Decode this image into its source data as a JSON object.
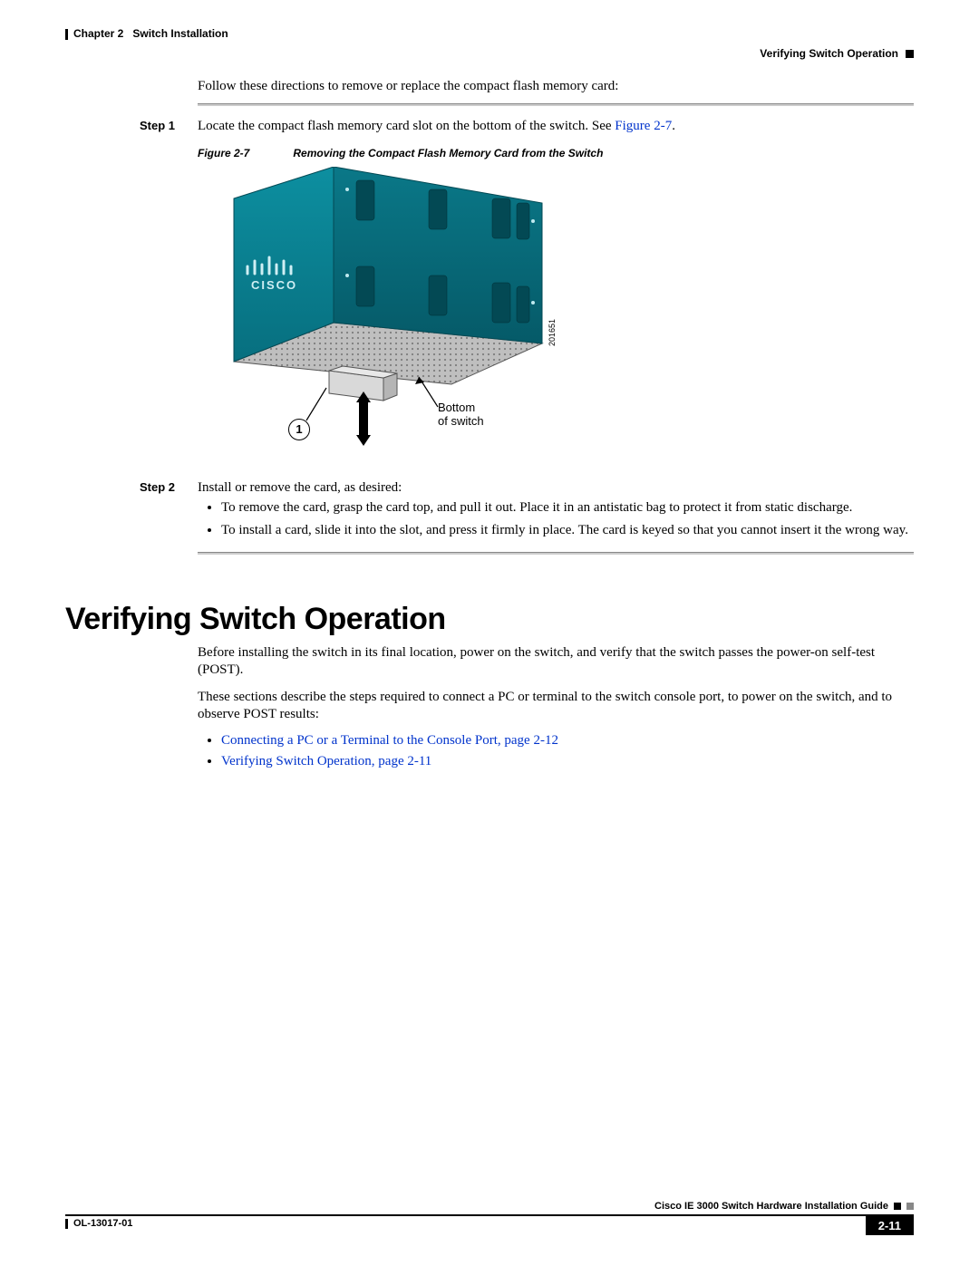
{
  "header": {
    "chapter": "Chapter 2",
    "chapter_title": "Switch Installation",
    "section": "Verifying Switch Operation"
  },
  "intro": "Follow these directions to remove or replace the compact flash memory card:",
  "steps": {
    "step1": {
      "label": "Step 1",
      "text": "Locate the compact flash memory card slot on the bottom of the switch. See ",
      "link": "Figure 2-7",
      "after": "."
    },
    "figure": {
      "ref": "Figure 2-7",
      "caption": "Removing the Compact Flash Memory Card from the Switch",
      "callout_number": "1",
      "bottom_label_1": "Bottom",
      "bottom_label_2": "of switch",
      "code": "201651"
    },
    "step2": {
      "label": "Step 2",
      "text": "Install or remove the card, as desired:",
      "bullets": [
        "To remove the card, grasp the card top, and pull it out. Place it in an antistatic bag to protect it from static discharge.",
        "To install a card, slide it into the slot, and press it firmly in place. The card is keyed so that you cannot insert it the wrong way."
      ]
    }
  },
  "section": {
    "heading": "Verifying Switch Operation",
    "p1": "Before installing the switch in its final location, power on the switch, and verify that the switch passes the power-on self-test (POST).",
    "p2": "These sections describe the steps required to connect a PC or terminal to the switch console port, to power on the switch, and to observe POST results:",
    "links": [
      "Connecting a PC or a Terminal to the Console Port, page 2-12",
      "Verifying Switch Operation, page 2-11"
    ]
  },
  "footer": {
    "guide": "Cisco IE 3000 Switch Hardware Installation Guide",
    "docnum": "OL-13017-01",
    "page": "2-11"
  }
}
